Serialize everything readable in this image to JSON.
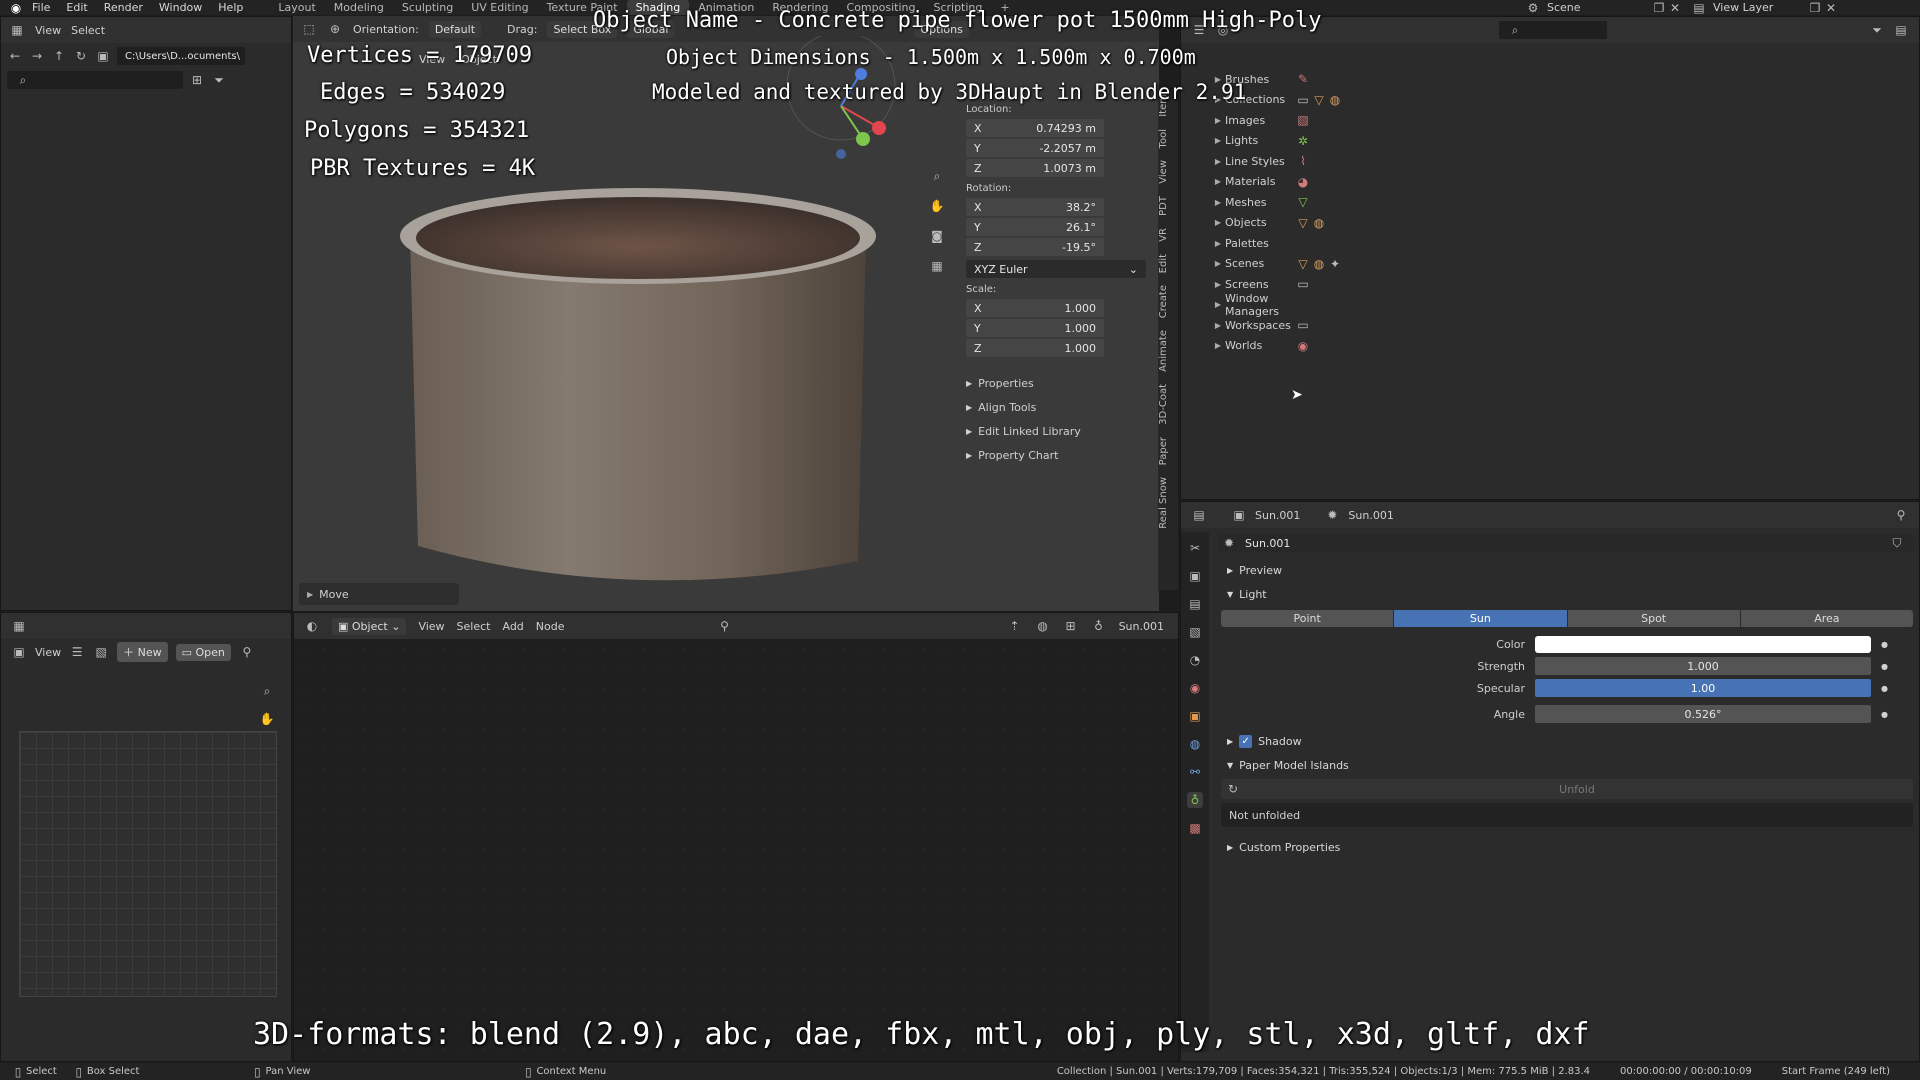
{
  "topbar": {
    "menus": [
      "File",
      "Edit",
      "Render",
      "Window",
      "Help"
    ],
    "workspaces": [
      "Layout",
      "Modeling",
      "Sculpting",
      "UV Editing",
      "Texture Paint",
      "Shading",
      "Animation",
      "Rendering",
      "Compositing",
      "Scripting"
    ],
    "active_workspace": "Shading",
    "add_tab": "+",
    "scene": "Scene",
    "view_layer": "View Layer"
  },
  "overlay": {
    "object_name": "Object Name - Concrete pipe flower pot 1500mm High-Poly",
    "vertices": "Vertices = 179709",
    "dimensions": "Object Dimensions - 1.500m x 1.500m x 0.700m",
    "edges": "Edges = 534029",
    "modeled_by": "Modeled and textured by 3DHaupt in Blender 2.91",
    "polygons": "Polygons = 354321",
    "pbr": "PBR Textures = 4K",
    "formats": "3D-formats: blend (2.9), abc, dae, fbx, mtl, obj, ply, stl, x3d, gltf, dxf"
  },
  "file_browser": {
    "view": "View",
    "select": "Select",
    "path": "C:\\Users\\D...ocuments\\",
    "search_placeholder": ""
  },
  "viewport": {
    "orientation_label": "Orientation:",
    "orientation_value": "Default",
    "drag_label": "Drag:",
    "drag_value": "Select Box",
    "transform_space": "Global",
    "options": "Options",
    "view": "View",
    "object": "Object",
    "last_op": "Move"
  },
  "transform": {
    "location_label": "Location:",
    "location": [
      {
        "axis": "X",
        "value": "0.74293 m"
      },
      {
        "axis": "Y",
        "value": "-2.2057 m"
      },
      {
        "axis": "Z",
        "value": "1.0073 m"
      }
    ],
    "rotation_label": "Rotation:",
    "rotation": [
      {
        "axis": "X",
        "value": "38.2°"
      },
      {
        "axis": "Y",
        "value": "26.1°"
      },
      {
        "axis": "Z",
        "value": "-19.5°"
      }
    ],
    "rotation_mode": "XYZ Euler",
    "scale_label": "Scale:",
    "scale": [
      {
        "axis": "X",
        "value": "1.000"
      },
      {
        "axis": "Y",
        "value": "1.000"
      },
      {
        "axis": "Z",
        "value": "1.000"
      }
    ],
    "panels": [
      "Properties",
      "Align Tools",
      "Edit Linked Library",
      "Property Chart"
    ]
  },
  "side_tabs": [
    "Item",
    "Tool",
    "View",
    "PDT",
    "VR",
    "Edit",
    "Create",
    "Animate",
    "3D-Coat",
    "Paper",
    "Real Snow"
  ],
  "outliner": {
    "items": [
      {
        "label": "Brushes"
      },
      {
        "label": "Collections"
      },
      {
        "label": "Images"
      },
      {
        "label": "Lights"
      },
      {
        "label": "Line Styles"
      },
      {
        "label": "Materials"
      },
      {
        "label": "Meshes"
      },
      {
        "label": "Objects"
      },
      {
        "label": "Palettes"
      },
      {
        "label": "Scenes"
      },
      {
        "label": "Screens"
      },
      {
        "label": "Window Managers"
      },
      {
        "label": "Workspaces"
      },
      {
        "label": "Worlds"
      }
    ]
  },
  "properties": {
    "breadcrumb_object": "Sun.001",
    "breadcrumb_data": "Sun.001",
    "datablock_name": "Sun.001",
    "preview": "Preview",
    "light": "Light",
    "light_types": [
      "Point",
      "Sun",
      "Spot",
      "Area"
    ],
    "active_type": "Sun",
    "color_label": "Color",
    "strength_label": "Strength",
    "strength_value": "1.000",
    "specular_label": "Specular",
    "specular_value": "1.00",
    "angle_label": "Angle",
    "angle_value": "0.526°",
    "shadow": "Shadow",
    "paper_model": "Paper Model Islands",
    "unfold": "Unfold",
    "not_unfolded": "Not unfolded",
    "custom_props": "Custom Properties"
  },
  "node_editor": {
    "object_mode": "Object",
    "menus": [
      "View",
      "Select",
      "Add",
      "Node"
    ],
    "active_object": "Sun.001"
  },
  "image_editor": {
    "view": "View",
    "new": "New",
    "open": "Open"
  },
  "statusbar": {
    "select": "Select",
    "box_select": "Box Select",
    "pan_view": "Pan View",
    "context_menu": "Context Menu",
    "stats": "Collection | Sun.001 | Verts:179,709 | Faces:354,321 | Tris:355,524 | Objects:1/3 | Mem: 775.5 MiB | 2.83.4",
    "time": "00:00:00:00 / 00:00:10:09",
    "frame": "Start Frame (249 left)"
  },
  "colors": {
    "accent": "#4772b3",
    "bg": "#1d1d1d",
    "panel": "#2b2b2b"
  }
}
